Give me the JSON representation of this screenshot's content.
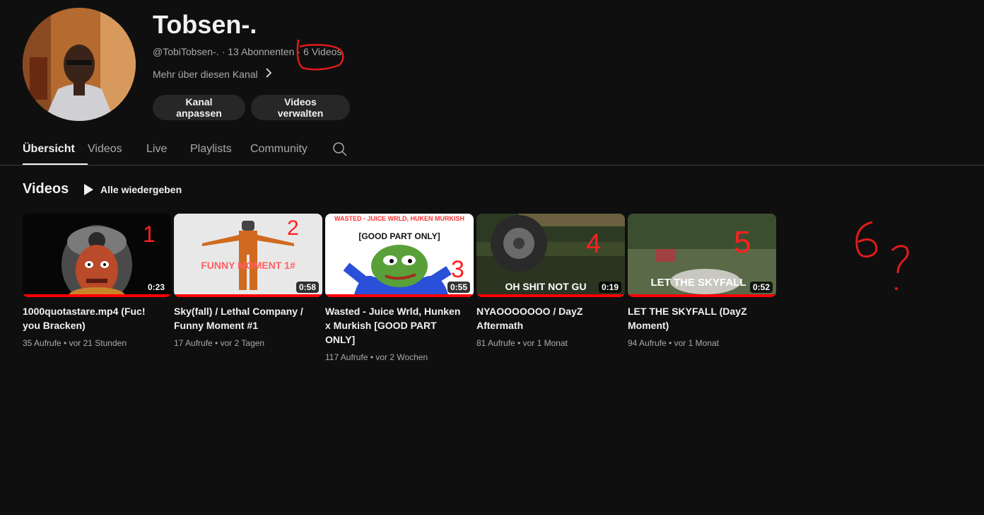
{
  "channel": {
    "name": "Tobsen-.",
    "handle": "@TobiTobsen-.",
    "subscribers": "13 Abonnenten",
    "video_count": "6 Videos",
    "more_label": "Mehr über diesen Kanal",
    "customize_label": "Kanal anpassen",
    "manage_label": "Videos verwalten"
  },
  "tabs": [
    {
      "label": "Übersicht",
      "active": true
    },
    {
      "label": "Videos",
      "active": false
    },
    {
      "label": "Live",
      "active": false
    },
    {
      "label": "Playlists",
      "active": false
    },
    {
      "label": "Community",
      "active": false
    }
  ],
  "section": {
    "title": "Videos",
    "play_all": "Alle wiedergeben"
  },
  "videos": [
    {
      "title": "1000quotastare.mp4 (Fuc! you Bracken)",
      "views": "35 Aufrufe",
      "age": "vor 21 Stunden",
      "duration": "0:23",
      "watched": 1.0
    },
    {
      "title": "Sky(fall) / Lethal Company / Funny Moment #1",
      "views": "17 Aufrufe",
      "age": "vor 2 Tagen",
      "duration": "0:58",
      "watched": 1.0,
      "thumb_text": "FUNNY MOMENT 1#"
    },
    {
      "title": "Wasted - Juice Wrld, Hunken x Murkish [GOOD PART ONLY]",
      "views": "117 Aufrufe",
      "age": "vor 2 Wochen",
      "duration": "0:55",
      "watched": 1.0,
      "thumb_text_top": "WASTED - JUICE WRLD, HUKEN MURKISH",
      "thumb_text_mid": "[GOOD PART ONLY]"
    },
    {
      "title": "NYAOOOOOOO / DayZ Aftermath",
      "views": "81 Aufrufe",
      "age": "vor 1 Monat",
      "duration": "0:19",
      "watched": 1.0,
      "thumb_text": "OH SHIT NOT GU"
    },
    {
      "title": "LET THE SKYFALL (DayZ Moment)",
      "views": "94 Aufrufe",
      "age": "vor 1 Monat",
      "duration": "0:52",
      "watched": 1.0,
      "thumb_text": "LET THE SKYFALL"
    }
  ],
  "colors": {
    "background": "#0f0f0f",
    "accent_red": "#ff0000",
    "annotation_red": "#e01b1b",
    "button_bg": "#272727"
  }
}
